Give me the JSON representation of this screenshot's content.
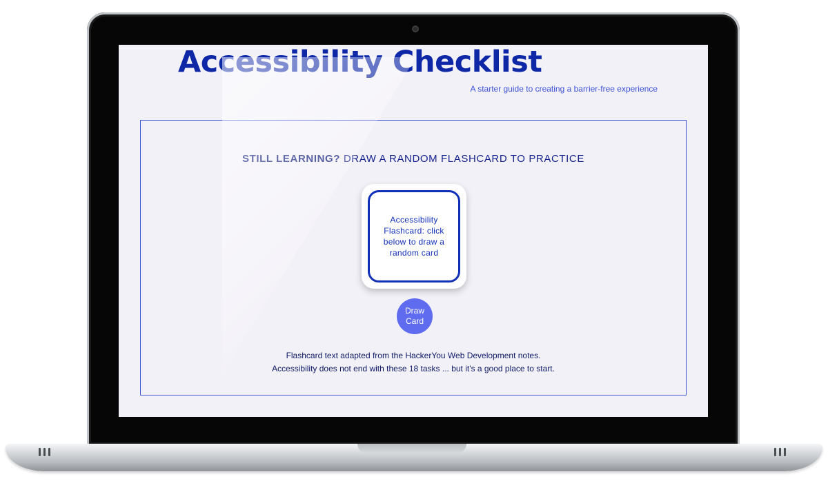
{
  "page": {
    "title": "Accessibility Checklist",
    "subtitle": "A starter guide to creating a barrier-free experience"
  },
  "flashcard_section": {
    "heading_strong": "STILL LEARNING?",
    "heading_rest": "DRAW A RANDOM FLASHCARD TO PRACTICE",
    "card_text": "Accessibility Flashcard: click below to draw a random card",
    "draw_button_label": "Draw Card",
    "footnote_1": "Flashcard text adapted from the HackerYou Web Development notes.",
    "footnote_2": "Accessibility does not end with these 18 tasks ... but it's a good place to start."
  },
  "colors": {
    "brand_blue": "#0e27a6",
    "accent_blue": "#3b52d4",
    "button_blue": "#5f6cf0",
    "screen_background": "#f3f1f8"
  }
}
